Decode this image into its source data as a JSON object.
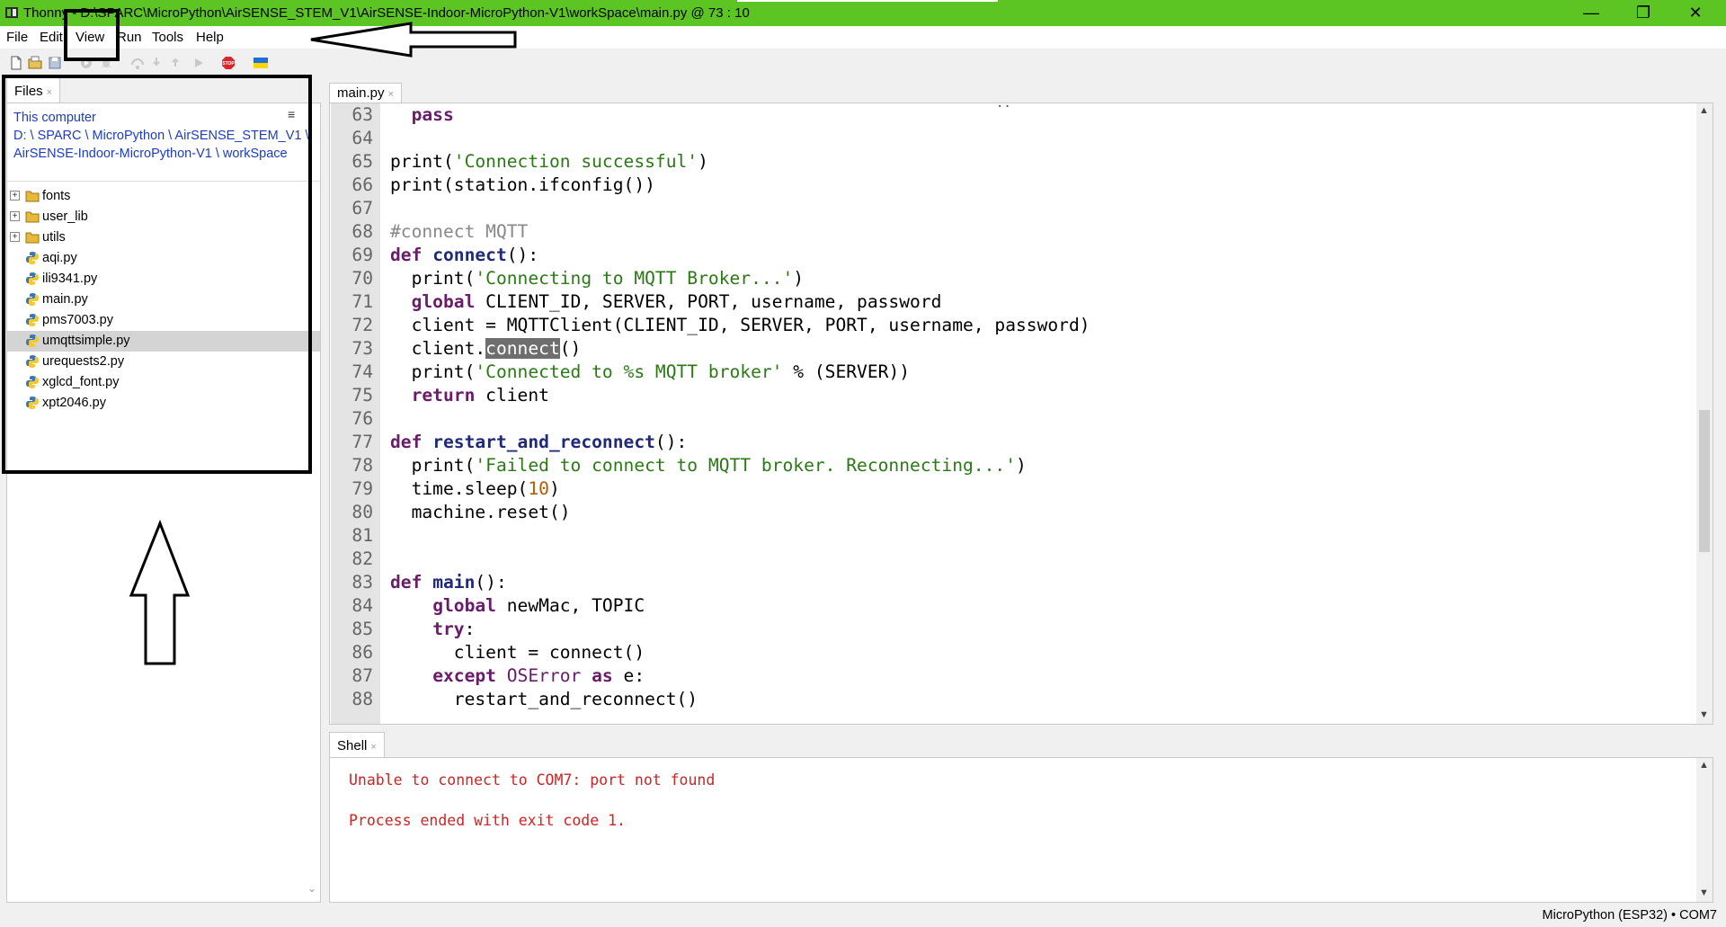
{
  "window": {
    "title": "Thonny - D:\\SPARC\\MicroPython\\AirSENSE_STEM_V1\\AirSENSE-Indoor-MicroPython-V1\\workSpace\\main.py @ 73 : 10",
    "title_prefix": "Thonny",
    "title_path": "D:\\SPARC\\MicroPython\\AirSENSE_STEM_V1\\AirSENSE-Indoor-MicroPython-V1\\workSpace\\main.py  @  73 : 10",
    "title_bar_color": "#5cc524",
    "controls": {
      "minimize": "—",
      "maximize": "❐",
      "close": "✕"
    }
  },
  "menubar": {
    "items": [
      "File",
      "Edit",
      "View",
      "Run",
      "Tools",
      "Help"
    ]
  },
  "toolbar": {
    "buttons": [
      "new-file-icon",
      "open-file-icon",
      "save-icon",
      "run-icon",
      "debug-icon",
      "step-over-icon",
      "step-into-icon",
      "step-out-icon",
      "resume-icon",
      "stop-icon",
      "ukraine-flag-icon"
    ],
    "stop_label": "STOP"
  },
  "files": {
    "tab_label": "Files",
    "tab_close": "×",
    "location_label": "This computer",
    "location_path": "D: \\ SPARC \\ MicroPython \\ AirSENSE_STEM_V1 \\ AirSENSE-Indoor-MicroPython-V1 \\ workSpace",
    "menu_icon": "≡",
    "items": [
      {
        "name": "fonts",
        "type": "folder"
      },
      {
        "name": "user_lib",
        "type": "folder"
      },
      {
        "name": "utils",
        "type": "folder"
      },
      {
        "name": "aqi.py",
        "type": "python"
      },
      {
        "name": "ili9341.py",
        "type": "python"
      },
      {
        "name": "main.py",
        "type": "python"
      },
      {
        "name": "pms7003.py",
        "type": "python"
      },
      {
        "name": "umqttsimple.py",
        "type": "python",
        "selected": true
      },
      {
        "name": "urequests2.py",
        "type": "python"
      },
      {
        "name": "xglcd_font.py",
        "type": "python"
      },
      {
        "name": "xpt2046.py",
        "type": "python"
      }
    ]
  },
  "editor": {
    "tab_label": "main.py",
    "tab_close": "×",
    "lines": [
      {
        "n": "63",
        "code": "  pass"
      },
      {
        "n": "64",
        "code": ""
      },
      {
        "n": "65",
        "code": "print('Connection successful')"
      },
      {
        "n": "66",
        "code": "print(station.ifconfig())"
      },
      {
        "n": "67",
        "code": ""
      },
      {
        "n": "68",
        "code": "#connect MQTT"
      },
      {
        "n": "69",
        "code": "def connect():"
      },
      {
        "n": "70",
        "code": "  print('Connecting to MQTT Broker...')"
      },
      {
        "n": "71",
        "code": "  global CLIENT_ID, SERVER, PORT, username, password"
      },
      {
        "n": "72",
        "code": "  client = MQTTClient(CLIENT_ID, SERVER, PORT, username, password)"
      },
      {
        "n": "73",
        "code": "  client.connect()"
      },
      {
        "n": "74",
        "code": "  print('Connected to %s MQTT broker' % (SERVER))"
      },
      {
        "n": "75",
        "code": "  return client"
      },
      {
        "n": "76",
        "code": ""
      },
      {
        "n": "77",
        "code": "def restart_and_reconnect():"
      },
      {
        "n": "78",
        "code": "  print('Failed to connect to MQTT broker. Reconnecting...')"
      },
      {
        "n": "79",
        "code": "  time.sleep(10)"
      },
      {
        "n": "80",
        "code": "  machine.reset()"
      },
      {
        "n": "81",
        "code": ""
      },
      {
        "n": "82",
        "code": ""
      },
      {
        "n": "83",
        "code": "def main():"
      },
      {
        "n": "84",
        "code": "    global newMac, TOPIC"
      },
      {
        "n": "85",
        "code": "    try:"
      },
      {
        "n": "86",
        "code": "      client = connect()"
      },
      {
        "n": "87",
        "code": "    except OSError as e:"
      },
      {
        "n": "88",
        "code": "      restart_and_reconnect()"
      }
    ],
    "top_dots": "..",
    "highlighted_word": "connect",
    "cursor_line": 73,
    "cursor_col": 10
  },
  "shell": {
    "tab_label": "Shell",
    "tab_close": "×",
    "lines": [
      "Unable to connect to COM7: port not found",
      "Process ended with exit code 1."
    ],
    "text_color": "#d22222"
  },
  "statusbar": {
    "text": "MicroPython (ESP32)  •  COM7"
  }
}
